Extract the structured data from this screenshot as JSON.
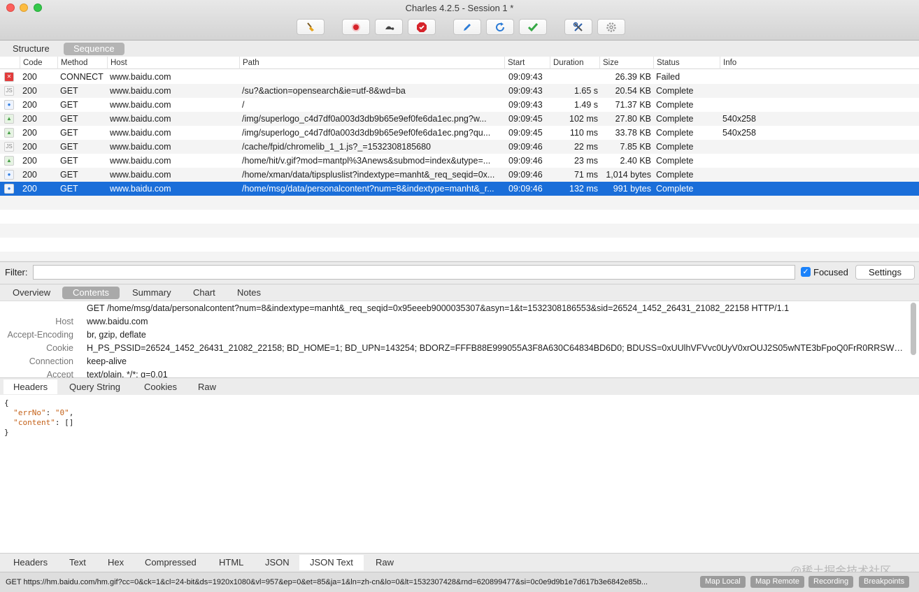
{
  "window": {
    "title": "Charles 4.2.5 - Session 1 *"
  },
  "toolbar": [
    {
      "name": "broom-icon",
      "color": "#e7a31c"
    },
    {
      "name": "record-icon",
      "color": "#d6232a"
    },
    {
      "name": "throttle-turtle-icon",
      "color": "#444444"
    },
    {
      "name": "breakpoint-icon",
      "color": "#d6232a"
    },
    {
      "name": "compose-pen-icon",
      "color": "#2b7bd6"
    },
    {
      "name": "repeat-icon",
      "color": "#2b7bd6"
    },
    {
      "name": "validate-check-icon",
      "color": "#35a845"
    },
    {
      "name": "tools-icon",
      "color": "#2b5ea8"
    },
    {
      "name": "settings-gear-icon",
      "color": "#999999"
    }
  ],
  "view_tabs": [
    {
      "label": "Structure"
    },
    {
      "label": "Sequence"
    }
  ],
  "columns": [
    "Code",
    "Method",
    "Host",
    "Path",
    "Start",
    "Duration",
    "Size",
    "Status",
    "Info"
  ],
  "rows": [
    {
      "icon": "failed-x-icon",
      "code": "200",
      "method": "CONNECT",
      "host": "www.baidu.com",
      "path": "",
      "start": "09:09:43",
      "duration": "",
      "size": "26.39 KB",
      "status": "Failed",
      "info": ""
    },
    {
      "icon": "js-file-icon",
      "code": "200",
      "method": "GET",
      "host": "www.baidu.com",
      "path": "/su?&action=opensearch&ie=utf-8&wd=ba",
      "start": "09:09:43",
      "duration": "1.65 s",
      "size": "20.54 KB",
      "status": "Complete",
      "info": ""
    },
    {
      "icon": "html-file-icon",
      "code": "200",
      "method": "GET",
      "host": "www.baidu.com",
      "path": "/",
      "start": "09:09:43",
      "duration": "1.49 s",
      "size": "71.37 KB",
      "status": "Complete",
      "info": ""
    },
    {
      "icon": "image-file-icon",
      "code": "200",
      "method": "GET",
      "host": "www.baidu.com",
      "path": "/img/superlogo_c4d7df0a003d3db9b65e9ef0fe6da1ec.png?w...",
      "start": "09:09:45",
      "duration": "102 ms",
      "size": "27.80 KB",
      "status": "Complete",
      "info": "540x258"
    },
    {
      "icon": "image-file-icon",
      "code": "200",
      "method": "GET",
      "host": "www.baidu.com",
      "path": "/img/superlogo_c4d7df0a003d3db9b65e9ef0fe6da1ec.png?qu...",
      "start": "09:09:45",
      "duration": "110 ms",
      "size": "33.78 KB",
      "status": "Complete",
      "info": "540x258"
    },
    {
      "icon": "js-file-icon",
      "code": "200",
      "method": "GET",
      "host": "www.baidu.com",
      "path": "/cache/fpid/chromelib_1_1.js?_=1532308185680",
      "start": "09:09:46",
      "duration": "22 ms",
      "size": "7.85 KB",
      "status": "Complete",
      "info": ""
    },
    {
      "icon": "image-file-icon",
      "code": "200",
      "method": "GET",
      "host": "www.baidu.com",
      "path": "/home/hit/v.gif?mod=mantpl%3Anews&submod=index&utype=...",
      "start": "09:09:46",
      "duration": "23 ms",
      "size": "2.40 KB",
      "status": "Complete",
      "info": ""
    },
    {
      "icon": "html-file-icon",
      "code": "200",
      "method": "GET",
      "host": "www.baidu.com",
      "path": "/home/xman/data/tipspluslist?indextype=manht&_req_seqid=0x...",
      "start": "09:09:46",
      "duration": "71 ms",
      "size": "1,014 bytes",
      "status": "Complete",
      "info": ""
    },
    {
      "icon": "html-file-icon",
      "code": "200",
      "method": "GET",
      "host": "www.baidu.com",
      "path": "/home/msg/data/personalcontent?num=8&indextype=manht&_r...",
      "start": "09:09:46",
      "duration": "132 ms",
      "size": "991 bytes",
      "status": "Complete",
      "info": ""
    }
  ],
  "filter": {
    "label": "Filter:",
    "value": "",
    "focused_label": "Focused",
    "settings_label": "Settings"
  },
  "detail_tabs": [
    {
      "label": "Overview"
    },
    {
      "label": "Contents"
    },
    {
      "label": "Summary"
    },
    {
      "label": "Chart"
    },
    {
      "label": "Notes"
    }
  ],
  "request_headers": [
    {
      "key": "",
      "value": "GET /home/msg/data/personalcontent?num=8&indextype=manht&_req_seqid=0x95eeeb9000035307&asyn=1&t=1532308186553&sid=26524_1452_26431_21082_22158 HTTP/1.1"
    },
    {
      "key": "Host",
      "value": "www.baidu.com"
    },
    {
      "key": "Accept-Encoding",
      "value": "br, gzip, deflate"
    },
    {
      "key": "Cookie",
      "value": "H_PS_PSSID=26524_1452_26431_21082_22158; BD_HOME=1; BD_UPN=143254; BDORZ=FFFB88E999055A3F8A630C64834BD6D0; BDUSS=0xUUlhVFVvc0UyV0xrOUJ2S05wNTE3bFpoQ0FrR0RRSWV..."
    },
    {
      "key": "Connection",
      "value": "keep-alive"
    },
    {
      "key": "Accept",
      "value": "text/plain, */*; q=0.01"
    }
  ],
  "request_tabs": [
    {
      "label": "Headers"
    },
    {
      "label": "Query String"
    },
    {
      "label": "Cookies"
    },
    {
      "label": "Raw"
    }
  ],
  "response_json": {
    "open": "{",
    "lines": [
      {
        "key": "\"errNo\"",
        "sep": ": ",
        "value": "\"0\"",
        "end": ","
      },
      {
        "key": "\"content\"",
        "sep": ": ",
        "value": "[]",
        "end": ""
      }
    ],
    "close": "}"
  },
  "response_tabs": [
    {
      "label": "Headers"
    },
    {
      "label": "Text"
    },
    {
      "label": "Hex"
    },
    {
      "label": "Compressed"
    },
    {
      "label": "HTML"
    },
    {
      "label": "JSON"
    },
    {
      "label": "JSON Text"
    },
    {
      "label": "Raw"
    }
  ],
  "status_bar": {
    "text": "GET https://hm.baidu.com/hm.gif?cc=0&ck=1&cl=24-bit&ds=1920x1080&vl=957&ep=0&et=85&ja=1&ln=zh-cn&lo=0&lt=1532307428&rnd=620899477&si=0c0e9d9b1e7d617b3e6842e85b...",
    "buttons": [
      {
        "label": "Map Local"
      },
      {
        "label": "Map Remote"
      },
      {
        "label": "Recording"
      },
      {
        "label": "Breakpoints"
      }
    ]
  },
  "watermark": "@稀土掘金技术社区",
  "colors": {
    "selection": "#1a6ed9",
    "accent": "#1a82fb",
    "json_key": "#c4621a"
  }
}
